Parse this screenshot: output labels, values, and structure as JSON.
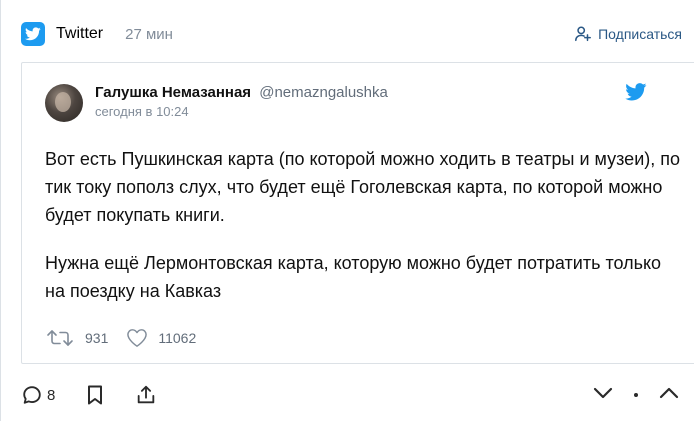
{
  "header": {
    "source_icon": "twitter-icon",
    "source_name": "Twitter",
    "time": "27 мин",
    "subscribe_label": "Подписаться",
    "accent": "#2a5885"
  },
  "tweet": {
    "author_name": "Галушка Немазанная",
    "author_handle": "@nemazngalushka",
    "date": "сегодня в 10:24",
    "paragraphs": [
      "Вот есть Пушкинская карта (по которой можно ходить в театры и музеи), по тик току пополз слух, что будет ещё Гоголевская карта, по которой можно будет покупать книги.",
      "Нужна ещё Лермонтовская карта, которую можно будет потратить только на поездку на Кавказ"
    ],
    "retweets": "931",
    "likes": "11062"
  },
  "actions": {
    "comments": "8"
  },
  "colors": {
    "twitter_blue": "#1d9bf0",
    "muted": "#818c99"
  }
}
